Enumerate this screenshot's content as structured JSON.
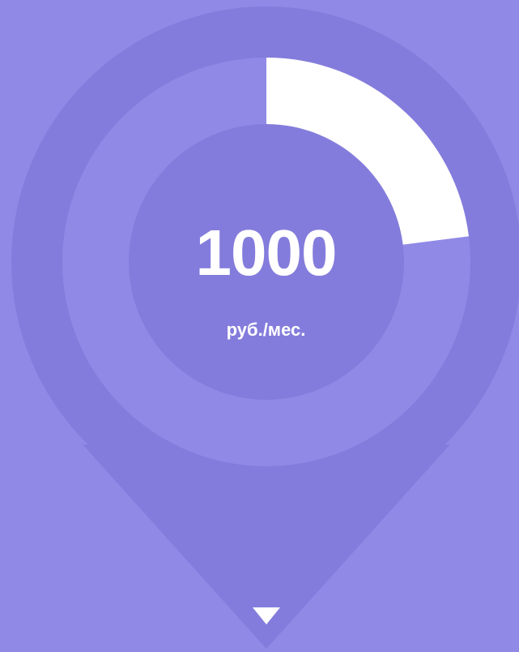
{
  "colors": {
    "background": "#9189e6",
    "pin": "#847cdc",
    "ring_track": "#9189e6",
    "ring_fill": "#ffffff",
    "inner_disc": "#847cdc",
    "text": "#ffffff"
  },
  "gauge": {
    "value": "1000",
    "unit": "руб./мес.",
    "fill_fraction": 0.23
  },
  "icons": {
    "pointer": "triangle-down-icon"
  }
}
